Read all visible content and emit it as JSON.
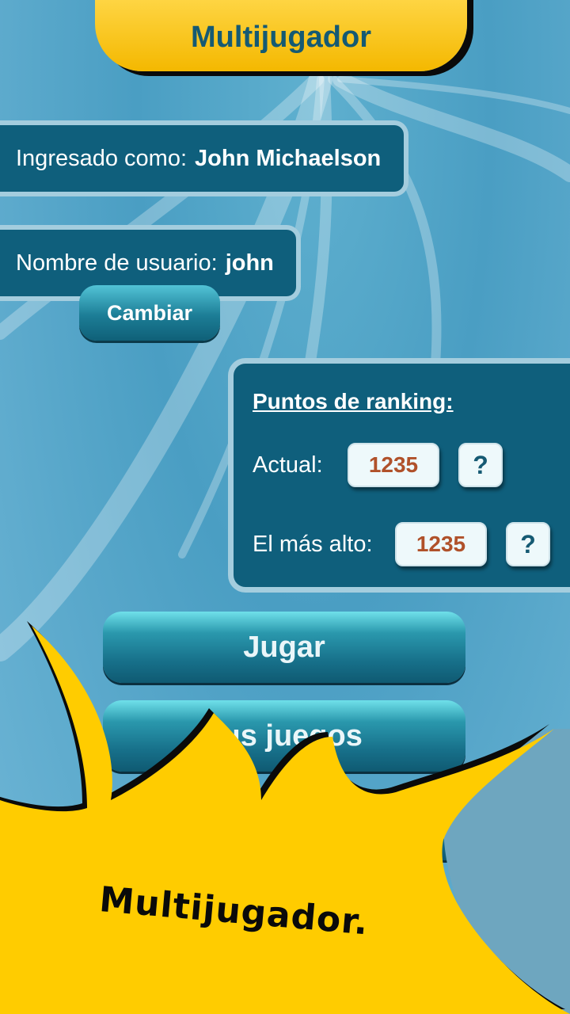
{
  "header": {
    "title": "Multijugador"
  },
  "account": {
    "logged_label": "Ingresado como:",
    "logged_name": "John Michaelson",
    "username_label": "Nombre de usuario:",
    "username": "john",
    "change_button": "Cambiar"
  },
  "ranking": {
    "title": "Puntos de ranking:",
    "current_label": "Actual:",
    "current_value": "1235",
    "highest_label": "El más alto:",
    "highest_value": "1235",
    "help_label": "?"
  },
  "menu": {
    "play_button": "Jugar",
    "games_button": "Tus juegos"
  },
  "overlay": {
    "banner_text": "Multijugador."
  },
  "colors": {
    "accent": "#0f5f7c",
    "brand_yellow": "#ffcc00",
    "score_text": "#b0512a"
  }
}
